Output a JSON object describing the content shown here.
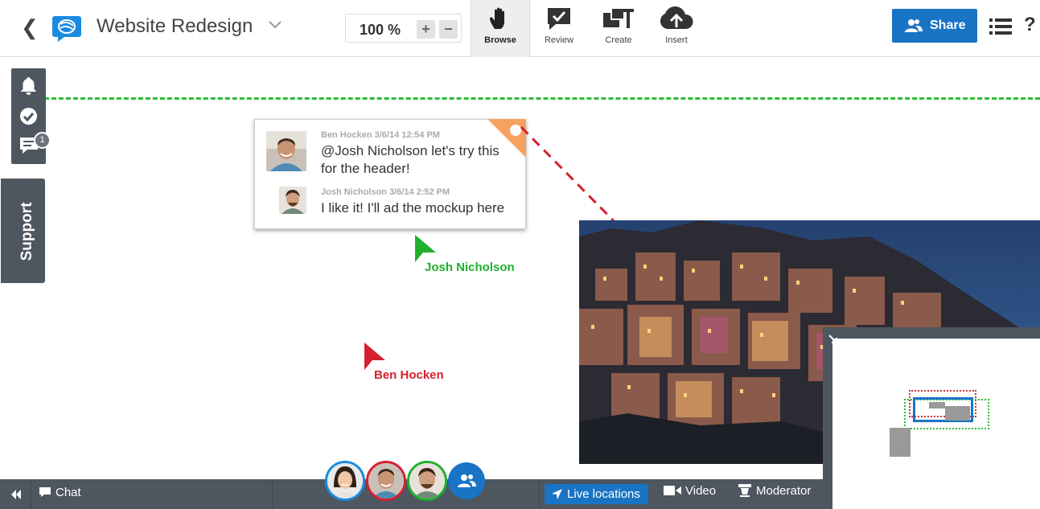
{
  "header": {
    "title": "Website Redesign",
    "zoom": "100 %",
    "zoom_in": "+",
    "zoom_out": "−",
    "tools": [
      {
        "label": "Browse",
        "icon": "hand-icon"
      },
      {
        "label": "Review",
        "icon": "review-icon"
      },
      {
        "label": "Create",
        "icon": "create-icon"
      },
      {
        "label": "Insert",
        "icon": "upload-cloud-icon"
      }
    ],
    "share_label": "Share",
    "help": "?"
  },
  "sidebar": {
    "notification_count": "1",
    "support_label": "Support"
  },
  "comment": {
    "messages": [
      {
        "author_time": "Ben Hocken 3/6/14 12:54 PM",
        "line1": "@Josh Nicholson let's try this",
        "line2": "for the header!"
      },
      {
        "author_time": "Josh Nicholson 3/6/14 2:52 PM",
        "text": "I like it! I'll ad the mockup here"
      }
    ]
  },
  "cursors": [
    {
      "name": "Josh Nicholson",
      "color": "#1fb02c"
    },
    {
      "name": "Ben Hocken",
      "color": "#d5202f"
    }
  ],
  "bottom_bar": {
    "chat_label": "Chat",
    "live_label": "Live locations",
    "video_label": "Video",
    "moderator_label": "Moderator"
  },
  "colors": {
    "accent": "#1a74c5",
    "panel": "#4e5660",
    "guide_line": "#2cbd35",
    "comment_corner": "#f6a160"
  }
}
